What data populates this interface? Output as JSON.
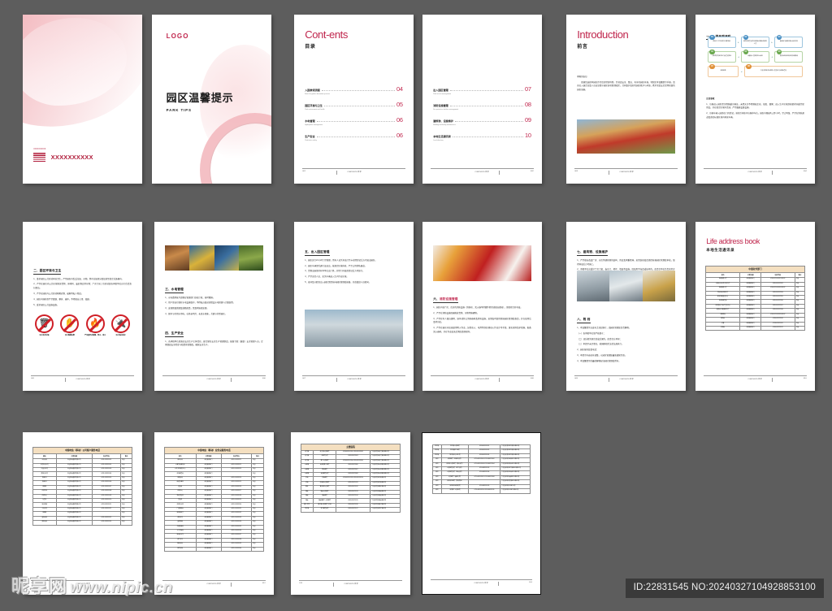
{
  "meta": {
    "watermark_cn": "昵享网",
    "watermark_url": "www.nipic.cn",
    "id_text": "ID:22831545 NO:20240327104928853100",
    "background_color": "#5d5d5d",
    "accent_color": "#c0264d",
    "table_header_color": "#f4dfc0"
  },
  "footers": {
    "contents_label": "CONTENTS 目录",
    "p001": "001",
    "p002": "002",
    "p003": "003",
    "p004": "004",
    "p005": "005",
    "p006": "006",
    "p007": "007",
    "p008": "008",
    "p009": "009",
    "p010": "010",
    "p011": "011",
    "p012": "012",
    "p013": "013",
    "p014": "014"
  },
  "cover": {
    "logo_tiny": "XXXXXXXXX",
    "logo_text": "XXXXXXXXXX"
  },
  "title_page": {
    "logo": "LOGO",
    "title_cn": "园区温馨提示",
    "title_en": "PARK TIPS"
  },
  "contents_left": {
    "heading_en": "Cont-ents",
    "heading_cn": "目录",
    "items": [
      {
        "cn": "入园参观流程",
        "en": "Enter the garden decoration process",
        "num": "04"
      },
      {
        "cn": "园区环境与卫生",
        "en": "Park environment and health",
        "num": "05"
      },
      {
        "cn": "水电管理",
        "en": "Hydropower management",
        "num": "06"
      },
      {
        "cn": "生产安全",
        "en": "Production safety",
        "num": "06"
      }
    ]
  },
  "contents_right": {
    "items": [
      {
        "cn": "出入园区管理",
        "en": "Park access management",
        "num": "07"
      },
      {
        "cn": "消防设施管理",
        "en": "Fire protection facilities management",
        "num": "08"
      },
      {
        "cn": "建筑物、设施维护",
        "en": "Building and facility maintenance",
        "num": "09"
      },
      {
        "cn": "本地生活通讯录",
        "en": "Local directory",
        "num": "10"
      }
    ]
  },
  "introduction": {
    "heading_en": "Introduction",
    "heading_cn": "前言",
    "lead": "尊敬的各位:",
    "body": "感谢您选择本园区作为您的经营场所。为营造安全、整洁、有序的园区环境，特制定本温馨提示手册。请各位入园企业及人员自觉遵守园区各项管理规定，共同维护良好的园区秩序与环境，携手营造安全文明和谐的园区氛围。"
  },
  "flow_page": {
    "section_title": "一、入园参观流程",
    "nodes": [
      {
        "n": "01",
        "color": "blue",
        "text": "提前1个工作日提交访客申请"
      },
      {
        "n": "02",
        "color": "blue",
        "text": "填写访客登记表并说明来访事由及陪同人员"
      },
      {
        "n": "03",
        "color": "blue",
        "text": "接待部门审核并确认来访时间"
      },
      {
        "n": "04",
        "color": "green",
        "text": "访客凭有效证件至门岗登记换证"
      },
      {
        "n": "05",
        "color": "green",
        "text": "由接待人员陪同进入园区"
      },
      {
        "n": "06",
        "color": "green",
        "text": "遵守园区安全规定及参观路线"
      },
      {
        "n": "07",
        "color": "orange",
        "text": "参观结束"
      },
      {
        "n": "08",
        "color": "orange",
        "text": "交还访客证并由陪同人员送至门岗离园登记"
      }
    ],
    "notes_title": "注意事项：",
    "notes": [
      "1、访客进入园区需全程佩戴访客证，未经允许不得随意走动、拍照、摄像；进入生产区域须按要求穿戴劳保用品，并在指定区域内活动，严禁触碰设备设施。",
      "2、访客车辆入园须在门岗登记，按指引停放于访客停车位，园区内限速5公里/小时，禁止鸣笛，严禁在消防通道及黄色标线区域内停放车辆。"
    ]
  },
  "env_page": {
    "section_title": "二、园区环境与卫生",
    "paragraphs": [
      "1、维护园区公共区域环境卫生，严禁园区内乱丢垃圾、杂物，所有垃圾须分类投放至指定垃圾桶内。",
      "2、严禁在园区内公共区域堆放货物、原材料、废旧物品等杂物；厂房门前三包区域由各承租单位自行负责清扫保洁。",
      "3、严禁在园区内公共区域晾晒衣物、被褥等私人物品。",
      "4、园区内绿化带严禁踩踏、攀折、破坏，不得擅自占用、改建。",
      "5、爱护园区公共设施设备。"
    ],
    "prohibitions": [
      {
        "icon": "no-littering-icon",
        "glyph": "🗑",
        "caption": "禁止乱扔垃圾"
      },
      {
        "icon": "no-touching-icon",
        "glyph": "✋",
        "caption": "禁止触摸设备"
      },
      {
        "icon": "no-open-flame-icon",
        "glyph": "🔥",
        "caption": "严禁园区内吸烟、明火、动火"
      },
      {
        "icon": "no-plug-icon",
        "glyph": "🔌",
        "caption": "禁止私拉乱接"
      }
    ]
  },
  "power_page": {
    "section_title_a": "三、水电管理",
    "paragraphs_a": [
      "1、水电费用按月由物业管理部门抄表计收，按时缴纳。",
      "2、用户须自行做好水电设施维护，不得私自改动或增设水电管线与计量装置。",
      "3、发现跑冒滴漏及线路隐患，需及时报修处理。",
      "4、倡导节约用水用电，杜绝长明灯、长流水现象，共建节约型园区。"
    ],
    "section_title_b": "四、生产安全",
    "paragraphs_b": [
      "1、各承租单位须落实安全生产主体责任，建立健全安全生产管理制度，配备专职（兼职）安全管理人员，定期组织安全检查与隐患排查整改，确保安全生产。"
    ]
  },
  "access_page": {
    "section_title": "五、出入园区管理",
    "paragraphs": [
      "1、园区实行24小时门禁管理，所有人员凭有效门禁卡或经登记后方可进出园区。",
      "2、园区车辆须凭通行证进出，按规定区域停放，严禁占用消防通道。",
      "3、货物出园须持有本单位出门条，并经门岗核验登记后方可放行。",
      "4、严禁无关人员、无关车辆进入生产作业区域。",
      "5、夜间及节假日出入园区需提前向园区管理处报备，并由值班人员陪同。"
    ]
  },
  "fire_page": {
    "section_title_prefix": "六、",
    "section_title_accent": "消防设施管理",
    "paragraphs": [
      "1、园区内各厂房、库房的消防设施（消防栓、灭火器不得挪作他用或擅自挪动），须保持完好有效。",
      "2、严禁在消防设施周围堆放货物、杂物等障碍物。",
      "3、严禁任何人擅自挪用、损坏或挤占消防器材及消防设施，如需临时使用须报园区管理处备案，并在使用后及时归位。",
      "4、严禁在园区内违规使用明火作业，如需动火、电焊等须办理动火作业许可手续，落实现场监护措施，配备灭火器材，并在作业结束后彻底清理现场。"
    ]
  },
  "maint_page": {
    "section_title_a": "七、建筑物、设施维护",
    "paragraphs_a": [
      "1、严禁擅自改变厂房、仓库等建筑物的结构、用途及承重墙体，如需装修改造须提前报园区管理处审批，取得同意后方可施工。",
      "2、承租单位应爱护厂房门窗、卷帘门、地坪、墙面等设施，因使用不当造成损坏的，由责任单位负责修复并承担费用。"
    ],
    "section_title_b": "八、附 则",
    "paragraphs_b": [
      "1、本温馨提示自发布之日起施行，由园区管理处负责解释。",
      "（一）各承租单位须严格遵守；",
      "（二）违反相关规定造成后果的，由责任方承担；",
      "（三）本提示未尽事宜，按国家相关法律法规执行。",
      "2、园区服务监督电话：",
      "3、本提示内容如有调整，以园区管理处最新通知为准。",
      "4、本温馨提示的最终解释权归园区管理处所有。"
    ]
  },
  "address_book_page": {
    "heading_en": "Life address book",
    "heading_cn": "本地生活通讯录",
    "caption": "中国对外部门",
    "columns": [
      "单位",
      "公司名称",
      "电话号码",
      "备注"
    ],
    "rows": [
      [
        "市政服务大厅",
        "政务服务部门",
        "0769-XXXXXXX1    转XXX",
        "中国"
      ],
      [
        "公安局·出入境·办证大厅",
        "政务服务部门",
        "0769-XXXXXXX2",
        "中国"
      ],
      [
        "市政服务大厅",
        "政务服务部门",
        "0769-XXXXXXX3    转XXX",
        "中国"
      ],
      [
        "劳动争议仲裁大厅",
        "政务服务部门",
        "0769-XXXXXXX4",
        "中国"
      ],
      [
        "职业技能鉴定中心",
        "政务服务部门",
        "0769-XXXXXXX5",
        "中国"
      ],
      [
        "市市场监管局",
        "政务服务部门",
        "0769-XXXXXXX6",
        "中国"
      ],
      [
        "市住建局·不动产登记中心",
        "政务服务部门",
        "0769-XXXXXXX7",
        "中国"
      ],
      [
        "税务局·办税服务大厅",
        "政务服务部门",
        "0769-XXXXXXX8",
        "中国"
      ],
      [
        "市医保局",
        "政务服务部门",
        "0769-XXXXXXX9    转XXX",
        "中国"
      ],
      [
        "消防局",
        "政务服务部门",
        "0769-XXXXXX10",
        "中国"
      ],
      [
        "交警",
        "政务服务部门",
        "0769-XXXXXX11",
        "中国"
      ],
      [
        "供电局",
        "政务服务部门",
        "0769-XXXXXX12",
        "中国"
      ]
    ]
  },
  "table_page_1": {
    "caption": "中国电信（移动）公司客户服务电话",
    "columns": [
      "城市",
      "公司名称",
      "电话号码",
      "备注"
    ],
    "rows": [
      [
        "公安分局",
        "中国移动通信有限公司",
        "0769-XXXXXX01",
        "中国"
      ],
      [
        "北京市分公司",
        "中国移动通信有限公司",
        "0769-XXXXXX02",
        "中国"
      ],
      [
        "中国分公司",
        "中国移动通信有限公司",
        "0769-XXXXXX03",
        "中国"
      ],
      [
        "南阳分公司",
        "中国移动通信有限公司",
        "0769-XXXXXX04",
        "中国"
      ],
      [
        "地级市1",
        "中国移动通信有限公司",
        "0769-XXXXXX05",
        "中国"
      ],
      [
        "地级市2",
        "中国移动通信有限公司",
        "0769-XXXXXX06",
        "中国"
      ],
      [
        "顺德区",
        "中国移动通信有限公司",
        "0769-XXXXXX07",
        "中国"
      ],
      [
        "开放大区",
        "中国移动通信有限公司",
        "0769-XXXXXX08",
        "中国"
      ],
      [
        "开放中心",
        "中国移动通信有限公司",
        "0769-XXXXXX09",
        "中国"
      ],
      [
        "分管办",
        "中国移动通信有限公司",
        "0769-XXXXXX10",
        "中国"
      ],
      [
        "宏业务部",
        "中国移动通信有限公司",
        "0769-XXXXXX11",
        "中国"
      ],
      [
        "三角公司",
        "中国移动通信有限公司",
        "0769-XXXXXX12",
        "中国"
      ],
      [
        "城镇区",
        "中国移动通信有限公司",
        "",
        "中国"
      ],
      [
        "国际分局",
        "中国移动通信有限公司",
        "0769-XXXXXX13",
        "中国"
      ],
      [
        "郑阳分局",
        "中国移动通信有限公司",
        "0769-XXXXXX14",
        "中国"
      ]
    ]
  },
  "table_page_2": {
    "caption": "中国电信（移动）业务总服务电话",
    "columns": [
      "单位",
      "公司名称",
      "电话号码",
      "备注"
    ],
    "rows": [
      [
        "城区分局",
        "政务服务部门",
        "0769-XXXXXX21",
        "中国"
      ],
      [
        "人事劳动服务局",
        "政务服务部门",
        "0769-XXXXXX22",
        "中国"
      ],
      [
        "公共卫生服务中心",
        "政务服务部门",
        "0769-XXXXXX23",
        "中国"
      ],
      [
        "市场监管局",
        "政务服务部门",
        "",
        "中国"
      ],
      [
        "城镇分局",
        "政务服务部门",
        "0769-XXXXXX24",
        "中国"
      ],
      [
        "街道办事处",
        "政务服务部门",
        "0769-XXXXXX25",
        "中国"
      ],
      [
        "建设局",
        "政务服务部门",
        "0769-XXXXXX26",
        "中国"
      ],
      [
        "环保中心",
        "政务服务部门",
        "0769-XXXXXX27",
        "中国"
      ],
      [
        "物业管理处",
        "政务服务部门",
        "0769-XXXXXX28",
        "中国"
      ],
      [
        "管理处",
        "政务服务部门",
        "0769-XXXXXX29",
        "中国"
      ],
      [
        "开放办公处",
        "政务服务部门",
        "0769-XXXXXX30",
        "中国"
      ],
      [
        "广播电视台",
        "政务服务部门",
        "0769-XXXXXX31",
        "中国"
      ],
      [
        "电信营业厅",
        "政务服务部门",
        "0769-XXXXXX32",
        "中国"
      ],
      [
        "保险公司",
        "政务服务部门",
        "0769-XXXXXX33",
        "中国"
      ],
      [
        "国家电网",
        "政务服务部门",
        "0769-XXXXXX34",
        "中国"
      ],
      [
        "交通运输局",
        "政务服务部门",
        "0769-XXXXXX35",
        "中国"
      ],
      [
        "人力资源局",
        "政务服务部门",
        "0769-XXXXXX36",
        "中国"
      ],
      [
        "自来水公司",
        "政务服务部门",
        "0769-XXXXXX37",
        "中国"
      ],
      [
        "燃气公司",
        "政务服务部门",
        "0769-XXXXXX38",
        "中国"
      ],
      [
        "邮政分局",
        "政务服务部门",
        "0769-XXXXXX39",
        "中国"
      ],
      [
        "医院分部",
        "政务服务部门",
        "0769-XXXXXX40",
        "中国"
      ]
    ]
  },
  "table_page_3": {
    "caption": "主要医院",
    "columns": [
      "区域",
      "医院名称",
      "电话号码",
      "地址"
    ],
    "rows": [
      [
        "虎门镇",
        "虎门镇人民医院",
        "0769-85XXXX01\n0769-85XXXX02",
        "广东省东莞市虎门镇XX路XX号"
      ],
      [
        "虎门镇",
        "中医院分院",
        "0769-85XXXX03",
        "广东省东莞市虎门镇XX路XX号"
      ],
      [
        "虎门镇",
        "第六人民医院",
        "0769-85XXXX04\n0769-85XXXX05",
        "广东省东莞市虎门镇XX路XX号"
      ],
      [
        "长安镇",
        "长安镇第二医院",
        "0769-85XXXX06",
        "广东省东莞市长安镇XX路XX号"
      ],
      [
        "长安镇",
        "第五医院",
        "0769-85XXXX07",
        "广东省东莞市长安镇XX路XX号"
      ],
      [
        "长安镇",
        "长安医院分院",
        "0769-85XXXX08",
        "广东省东莞市长安镇XX路XX号"
      ],
      [
        "厚街",
        "厚街医院",
        "0769-85XXXX09\n0769-85XXXX10",
        "广东省东莞市厚街镇XX号"
      ],
      [
        "厚街",
        "厚街镇人民医院",
        "0769-85XXXX11",
        "广东省东莞市厚街镇XX号"
      ],
      [
        "寮步",
        "寮步镇中心医院",
        "0769-85XXXX12",
        "广东省东莞市寮步镇XX号"
      ],
      [
        "塘厦",
        "塘厦人民医院",
        "0769-85XXXX13",
        "广东省东莞市塘厦镇XX号"
      ],
      [
        "塘厦",
        "塘厦医院",
        "0769-85XXXX14",
        "广东省东莞市塘厦镇XX号"
      ],
      [
        "塘厦",
        "塘厦镇第二人民医院",
        "0769-85XXXX15",
        "广东省东莞市塘厦镇XX号"
      ],
      [
        "黄江·常平",
        "黄江镇人民医院门诊部",
        "0769-85XXXX16",
        "广东省东莞市黄江镇XX号"
      ],
      [
        "常平镇",
        "常平医院总院",
        "0769-85XXXX17",
        "广东省东莞市常平镇XX号"
      ]
    ]
  },
  "table_page_4": {
    "columns": [
      "区域",
      "医院名称",
      "电话号码",
      "地址"
    ],
    "rows": [
      [
        "常平镇",
        "常平镇人民医院",
        "0769-85XXXX41",
        "广东省东莞市常平镇XX路XX号"
      ],
      [
        "常平镇",
        "常平镇第二医院",
        "0769-85XXXX42",
        "广东省东莞市常平镇XX路XX号"
      ],
      [
        "常平镇",
        "常平镇中心卫生院",
        "0769-85XXXX43",
        "广东省东莞市常平镇XX路XX号"
      ],
      [
        "深圳",
        "深圳医院（宝安区分院）",
        "0755-88XXXX01\n0755-88XXXX02",
        "广东省深圳市宝安区XX路XX号"
      ],
      [
        "深圳",
        "深圳市人民医院（南山分院）",
        "0755-88XXXX03\n0755-88XXXX04",
        "广东省深圳市南山区XX路XX号"
      ],
      [
        "深圳",
        "人民医院分院（龙华分院）",
        "0755-88XXXX05",
        "广东省深圳市龙华新区XX路XX号"
      ],
      [
        "深圳",
        "人民医院分院（龙岗分院）",
        "0755-88XXXX06",
        "广东省深圳市龙岗区XX路XX号"
      ],
      [
        "深圳",
        "人民医院（福田分院）",
        "0755-88XXXX07\n0755-88XXXX08",
        "广东省深圳市福田区XX路XX号"
      ],
      [
        "深圳",
        "深圳市中医院（罗湖院区）",
        "",
        "广东省深圳市罗湖区XX路XX号"
      ],
      [
        "深圳",
        "深圳市妇幼保健院",
        "0755-88XXXX09",
        "广东省深圳市XX区XX号"
      ],
      [
        "深圳",
        "深圳第二人民医院",
        "0755-88XXXX10\n0755-88XXXX11",
        "广东省深圳市XX区XX路XX号"
      ]
    ]
  }
}
